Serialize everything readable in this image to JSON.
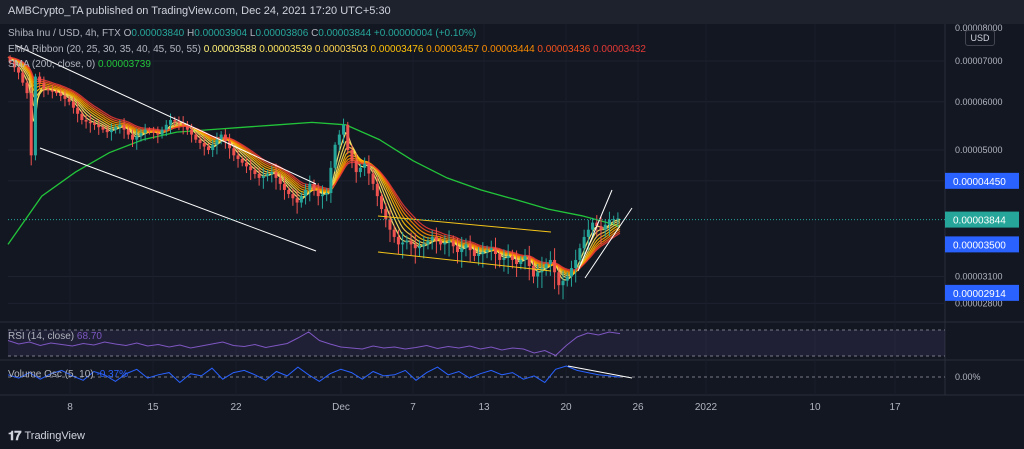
{
  "publisher": "AMBCrypto_TA published on TradingView.com, Dec 24, 2021 17:20 UTC+5:30",
  "legend": {
    "symbol": "Shiba Inu / USD, 4h, FTX",
    "open_label": "O",
    "open": "0.00003840",
    "high_label": "H",
    "high": "0.00003904",
    "low_label": "L",
    "low": "0.00003806",
    "close_label": "C",
    "close": "0.00003844",
    "change": "+0.00000004 (+0.10%)",
    "ema_title": "EMA Ribbon (20, 25, 30, 35, 40, 45, 50, 55)",
    "ema_values": [
      "0.00003588",
      "0.00003539",
      "0.00003503",
      "0.00003476",
      "0.00003457",
      "0.00003444",
      "0.00003436",
      "0.00003432"
    ],
    "sma_title": "SMA (200, close, 0)",
    "sma_value": "0.00003739"
  },
  "currency": "USD",
  "branding": "TradingView",
  "colors": {
    "background": "#131722",
    "sma": "#22c53a",
    "rsi": "#7e57c2",
    "volume_osc": "#2962ff",
    "channel": "#ffffff",
    "wedge": "#f5c518",
    "ema_ribbon": [
      "#fff176",
      "#ffe45c",
      "#ffd54f",
      "#ffc107",
      "#ffa000",
      "#fb8c00",
      "#f4511e",
      "#e53935"
    ]
  },
  "chart_data": [
    {
      "type": "candlestick",
      "title": "Shiba Inu / USD, 4h, FTX",
      "x_ticks": [
        "8",
        "15",
        "22",
        "Dec",
        "7",
        "13",
        "20",
        "26",
        "2022",
        "10",
        "17"
      ],
      "y_ticks": [
        "0.00002800",
        "0.00003100",
        "0.00004450",
        "0.00005000",
        "0.00006000",
        "0.00007000"
      ],
      "y_tick_top": "0.00008000",
      "ylim": [
        2.65e-05,
        8.05e-05
      ],
      "price_markers": [
        {
          "label": "0.00004450",
          "value": 4.45e-05,
          "color": "#2962ff"
        },
        {
          "label": "0.00003844",
          "value": 3.844e-05,
          "color": "#26a69a"
        },
        {
          "label": "0.00003500",
          "value": 3.5e-05,
          "color": "#2962ff"
        },
        {
          "label": "0.00002914",
          "value": 2.914e-05,
          "color": "#2962ff"
        }
      ],
      "price_path": [
        [
          0,
          7.1
        ],
        [
          3,
          6.7
        ],
        [
          5,
          6.2
        ],
        [
          6,
          4.9
        ],
        [
          7,
          6.6
        ],
        [
          9,
          6.3
        ],
        [
          12,
          6.2
        ],
        [
          15,
          6.0
        ],
        [
          18,
          5.6
        ],
        [
          21,
          5.5
        ],
        [
          24,
          5.35
        ],
        [
          27,
          5.5
        ],
        [
          30,
          5.2
        ],
        [
          33,
          5.4
        ],
        [
          36,
          5.3
        ],
        [
          39,
          5.6
        ],
        [
          42,
          5.5
        ],
        [
          45,
          5.2
        ],
        [
          48,
          5.0
        ],
        [
          51,
          5.3
        ],
        [
          54,
          4.9
        ],
        [
          57,
          4.7
        ],
        [
          60,
          4.5
        ],
        [
          63,
          4.6
        ],
        [
          66,
          4.3
        ],
        [
          69,
          4.1
        ],
        [
          72,
          4.4
        ],
        [
          74,
          4.2
        ],
        [
          76,
          4.25
        ],
        [
          78,
          5.1
        ],
        [
          80,
          5.5
        ],
        [
          81,
          5.0
        ],
        [
          83,
          4.6
        ],
        [
          85,
          4.75
        ],
        [
          87,
          4.4
        ],
        [
          89,
          4.0
        ],
        [
          91,
          3.7
        ],
        [
          93,
          3.5
        ],
        [
          95,
          3.55
        ],
        [
          97,
          3.45
        ],
        [
          99,
          3.5
        ],
        [
          101,
          3.6
        ],
        [
          103,
          3.5
        ],
        [
          105,
          3.55
        ],
        [
          107,
          3.4
        ],
        [
          109,
          3.5
        ],
        [
          111,
          3.35
        ],
        [
          113,
          3.4
        ],
        [
          115,
          3.45
        ],
        [
          117,
          3.3
        ],
        [
          119,
          3.35
        ],
        [
          121,
          3.25
        ],
        [
          123,
          3.35
        ],
        [
          125,
          3.1
        ],
        [
          127,
          3.2
        ],
        [
          129,
          3.3
        ],
        [
          131,
          3.0
        ],
        [
          133,
          3.1
        ],
        [
          135,
          3.3
        ],
        [
          137,
          3.6
        ],
        [
          139,
          3.8
        ],
        [
          141,
          3.7
        ],
        [
          143,
          3.84
        ],
        [
          145,
          3.86
        ]
      ],
      "sma200_path": [
        [
          0,
          3.5
        ],
        [
          8,
          4.2
        ],
        [
          16,
          4.6
        ],
        [
          24,
          4.95
        ],
        [
          32,
          5.2
        ],
        [
          40,
          5.35
        ],
        [
          48,
          5.4
        ],
        [
          56,
          5.45
        ],
        [
          64,
          5.5
        ],
        [
          72,
          5.55
        ],
        [
          80,
          5.5
        ],
        [
          88,
          5.2
        ],
        [
          96,
          4.8
        ],
        [
          104,
          4.5
        ],
        [
          112,
          4.3
        ],
        [
          120,
          4.15
        ],
        [
          128,
          4.0
        ],
        [
          136,
          3.9
        ],
        [
          142,
          3.8
        ],
        [
          145,
          3.74
        ]
      ]
    },
    {
      "type": "line",
      "title": "RSI (14, close)",
      "current": "68.70",
      "band": [
        30,
        70
      ],
      "values": [
        55,
        48,
        52,
        45,
        50,
        47,
        44,
        49,
        46,
        52,
        48,
        45,
        50,
        44,
        47,
        42,
        46,
        40,
        44,
        48,
        52,
        45,
        43,
        47,
        41,
        45,
        49,
        60,
        72,
        55,
        48,
        42,
        40,
        38,
        44,
        40,
        42,
        38,
        41,
        45,
        39,
        43,
        40,
        44,
        38,
        42,
        36,
        40,
        38,
        30,
        35,
        25,
        45,
        62,
        70,
        66,
        72,
        68.7
      ]
    },
    {
      "type": "line",
      "title": "Volume Osc (5, 10)",
      "current": "-0.37%",
      "zero_label": "0.00%",
      "values": [
        10,
        -5,
        20,
        -10,
        15,
        30,
        5,
        -15,
        25,
        10,
        -20,
        15,
        35,
        -5,
        10,
        20,
        -25,
        15,
        5,
        40,
        -10,
        20,
        30,
        10,
        -15,
        25,
        5,
        45,
        10,
        -20,
        15,
        35,
        20,
        -10,
        25,
        5,
        10,
        30,
        -15,
        20,
        45,
        10,
        25,
        -5,
        15,
        30,
        10,
        20,
        -10,
        5,
        -25,
        35,
        50,
        30,
        20,
        10,
        5,
        -0.37
      ]
    }
  ]
}
